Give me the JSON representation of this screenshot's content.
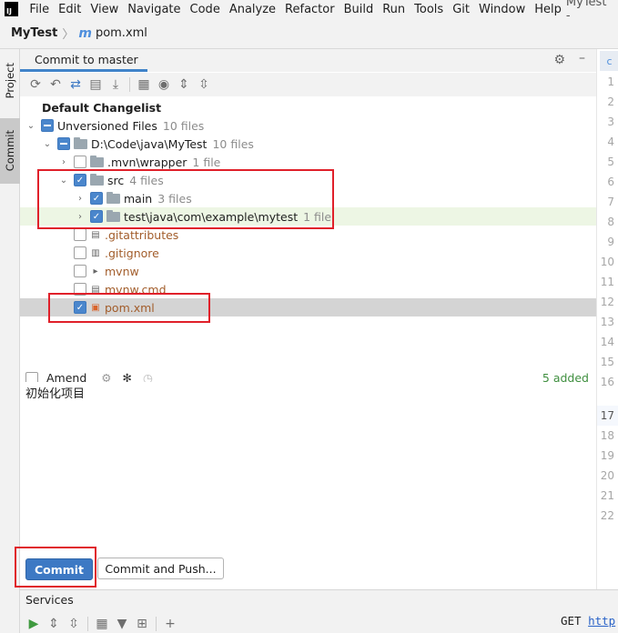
{
  "menubar": {
    "logo": "IJ",
    "items": [
      "File",
      "Edit",
      "View",
      "Navigate",
      "Code",
      "Analyze",
      "Refactor",
      "Build",
      "Run",
      "Tools",
      "Git",
      "Window",
      "Help"
    ],
    "title": "MyTest -"
  },
  "navbar": {
    "project": "MyTest",
    "file_icon": "m",
    "file": "pom.xml"
  },
  "left_strip": {
    "project_tab": "Project",
    "commit_tab": "Commit"
  },
  "panel": {
    "tab": "Commit to master",
    "toolbar_icons": [
      "refresh-icon",
      "rollback-icon",
      "diff-icon",
      "shelve-icon",
      "update-icon",
      "group-icon",
      "eye-icon",
      "expand-all-icon",
      "collapse-all-icon"
    ]
  },
  "tree": {
    "changelist": "Default Changelist",
    "unversioned": {
      "label": "Unversioned Files",
      "count": "10 files"
    },
    "root": {
      "label": "D:\\Code\\java\\MyTest",
      "count": "10 files"
    },
    "mvn": {
      "label": ".mvn\\wrapper",
      "count": "1 file"
    },
    "src": {
      "label": "src",
      "count": "4 files"
    },
    "main": {
      "label": "main",
      "count": "3 files"
    },
    "test": {
      "label": "test\\java\\com\\example\\mytest",
      "count": "1 file"
    },
    "files": [
      {
        "label": ".gitattributes"
      },
      {
        "label": ".gitignore"
      },
      {
        "label": "mvnw"
      },
      {
        "label": "mvnw.cmd"
      }
    ],
    "pom": {
      "label": "pom.xml"
    }
  },
  "amend": {
    "label": "Amend",
    "added": "5 added"
  },
  "message": {
    "text": "初始化项目"
  },
  "buttons": {
    "commit": "Commit",
    "commit_push": "Commit and Push..."
  },
  "gutter": {
    "tab_icon": "c",
    "lines": [
      "1",
      "2",
      "3",
      "4",
      "5",
      "6",
      "7",
      "8",
      "9",
      "10",
      "11",
      "12",
      "13",
      "14",
      "15",
      "16",
      "17",
      "18",
      "19",
      "20",
      "21",
      "22"
    ]
  },
  "services": {
    "title": "Services",
    "get_prefix": "GET",
    "get_url": "http"
  },
  "colors": {
    "accent": "#3d79c4",
    "annotation_red": "#e0202a",
    "unversioned_brown": "#a25d2b",
    "added_green": "#3f8f3f"
  }
}
